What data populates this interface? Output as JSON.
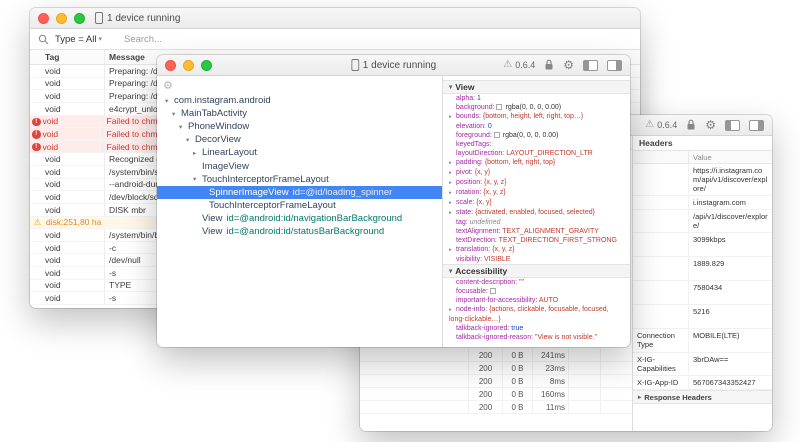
{
  "icons": {
    "warning": "⚠",
    "gear": "⚙",
    "chevron_down": "▾",
    "arrow_down": "▾",
    "arrow_right": "▸",
    "error_mark": "!"
  },
  "colors": {
    "selection_blue": "#4285f4",
    "error_red": "#cf3934",
    "warning_orange": "#e0891f",
    "prop_name_purple": "#a626a4",
    "enum_red": "#c0392b",
    "number_blue": "#1048bf",
    "tree_id_teal": "#00796b"
  },
  "log_window": {
    "title": "1 device running",
    "filter_label": "Type = All",
    "search_placeholder": "Search...",
    "columns": [
      "Tag",
      "Message"
    ],
    "rows": [
      {
        "severity": "normal",
        "tag": "void",
        "message": "Preparing: /data"
      },
      {
        "severity": "normal",
        "tag": "void",
        "message": "Preparing: /data"
      },
      {
        "severity": "normal",
        "tag": "void",
        "message": "Preparing: /data"
      },
      {
        "severity": "normal",
        "tag": "void",
        "message": "e4crypt_unlock_"
      },
      {
        "severity": "error",
        "tag": "void",
        "message": "Failed to chmod"
      },
      {
        "severity": "error",
        "tag": "void",
        "message": "Failed to chmod"
      },
      {
        "severity": "error",
        "tag": "void",
        "message": "Failed to chmod"
      },
      {
        "severity": "normal",
        "tag": "void",
        "message": "Recognized expe"
      },
      {
        "severity": "normal",
        "tag": "void",
        "message": "/system/bin/sgd"
      },
      {
        "severity": "normal",
        "tag": "void",
        "message": "--android-dump"
      },
      {
        "severity": "normal",
        "tag": "void",
        "message": "/dev/block/sd"
      },
      {
        "severity": "normal",
        "tag": "void",
        "message": "DISK mbr"
      },
      {
        "severity": "warning",
        "tag": "",
        "message": "disk:251,80 ha",
        "span": true
      },
      {
        "severity": "normal",
        "tag": "void",
        "message": "/system/bin/blk"
      },
      {
        "severity": "normal",
        "tag": "void",
        "message": "-c"
      },
      {
        "severity": "normal",
        "tag": "void",
        "message": "/dev/null"
      },
      {
        "severity": "normal",
        "tag": "void",
        "message": "-s"
      },
      {
        "severity": "normal",
        "tag": "void",
        "message": "TYPE"
      },
      {
        "severity": "normal",
        "tag": "void",
        "message": "-s"
      }
    ]
  },
  "layout_window": {
    "title": "1 device running",
    "version": "0.6.4",
    "tree": [
      {
        "indent": 0,
        "arrow": "down",
        "label": "com.instagram.android"
      },
      {
        "indent": 1,
        "arrow": "down",
        "label": "MainTabActivity"
      },
      {
        "indent": 2,
        "arrow": "down",
        "label": "PhoneWindow"
      },
      {
        "indent": 3,
        "arrow": "down",
        "label": "DecorView"
      },
      {
        "indent": 4,
        "arrow": "right",
        "label": "LinearLayout"
      },
      {
        "indent": 4,
        "arrow": "none",
        "label": "ImageView"
      },
      {
        "indent": 4,
        "arrow": "down",
        "label": "TouchInterceptorFrameLayout"
      },
      {
        "indent": 5,
        "arrow": "none",
        "label": "SpinnerImageView",
        "id": "id=@id/loading_spinner",
        "selected": true
      },
      {
        "indent": 5,
        "arrow": "none",
        "label": "TouchInterceptorFrameLayout"
      },
      {
        "indent": 4,
        "arrow": "none",
        "label": "View",
        "id": "id=@android:id/navigationBarBackground"
      },
      {
        "indent": 4,
        "arrow": "none",
        "label": "View",
        "id": "id=@android:id/statusBarBackground"
      }
    ],
    "sections": [
      {
        "title": "View",
        "props": [
          {
            "name": "alpha",
            "value": "1",
            "type": "number"
          },
          {
            "name": "background",
            "value": "rgba(0, 0, 0, 0.00)",
            "type": "color"
          },
          {
            "name": "bounds",
            "value": "{bottom, height, left, right, top…}",
            "type": "object"
          },
          {
            "name": "elevation",
            "value": "0",
            "type": "number"
          },
          {
            "name": "foreground",
            "value": "rgba(0, 0, 0, 0.00)",
            "type": "color"
          },
          {
            "name": "keyedTags",
            "value": "",
            "type": "empty"
          },
          {
            "name": "layoutDirection",
            "value": "LAYOUT_DIRECTION_LTR",
            "type": "enum"
          },
          {
            "name": "padding",
            "value": "{bottom, left, right, top}",
            "type": "object"
          },
          {
            "name": "pivot",
            "value": "{x, y}",
            "type": "object"
          },
          {
            "name": "position",
            "value": "{x, y, z}",
            "type": "object"
          },
          {
            "name": "rotation",
            "value": "{x, y, z}",
            "type": "object"
          },
          {
            "name": "scale",
            "value": "{x, y}",
            "type": "object"
          },
          {
            "name": "state",
            "value": "{activated, enabled, focused, selected}",
            "type": "object"
          },
          {
            "name": "tag",
            "value": "undefined",
            "type": "undefined"
          },
          {
            "name": "textAlignment",
            "value": "TEXT_ALIGNMENT_GRAVITY",
            "type": "enum"
          },
          {
            "name": "textDirection",
            "value": "TEXT_DIRECTION_FIRST_STRONG",
            "type": "enum"
          },
          {
            "name": "translation",
            "value": "{x, y, z}",
            "type": "object"
          },
          {
            "name": "visibility",
            "value": "VISIBLE",
            "type": "enum"
          }
        ]
      },
      {
        "title": "Accessibility",
        "props": [
          {
            "name": "content-description",
            "value": "\"\"",
            "type": "string"
          },
          {
            "name": "focusable",
            "value": "",
            "type": "checkbox"
          },
          {
            "name": "important-for-accessibility",
            "value": "AUTO",
            "type": "enum"
          },
          {
            "name": "node-info",
            "value": "{actions, clickable, focusable, focused, long-clickable…}",
            "type": "object"
          },
          {
            "name": "talkback-ignored",
            "value": "true",
            "type": "boolean"
          },
          {
            "name": "talkback-ignored-reason",
            "value": "\"View is not visible.\"",
            "type": "string"
          }
        ]
      }
    ]
  },
  "network_window": {
    "version": "0.6.4",
    "detail": {
      "title": "Headers",
      "value_column": "Value",
      "rows": [
        {
          "name": "",
          "value": "https://i.instagram.com/api/v1/discover/explore/"
        },
        {
          "name": "",
          "value": "i.instagram.com"
        },
        {
          "name": "",
          "value": "/api/v1/discover/explore/"
        },
        {
          "name": "",
          "value": "3099kbps",
          "tall": true
        },
        {
          "name": "",
          "value": "1889.829",
          "tall": true
        },
        {
          "name": "",
          "value": "7580434",
          "tall": true
        },
        {
          "name": "",
          "value": "5216",
          "tall": true
        },
        {
          "name": "Connection Type",
          "value": "MOBILE(LTE)",
          "tall": true
        },
        {
          "name": "X-IG-Capabilities",
          "value": "3brDAw=="
        },
        {
          "name": "X-IG-App-ID",
          "value": "567067343352427"
        }
      ],
      "section": "Response Headers"
    },
    "requests": [
      {
        "url": "",
        "status": "200",
        "size": "0 B",
        "time": "241ms"
      },
      {
        "url": "",
        "status": "200",
        "size": "0 B",
        "time": "23ms"
      },
      {
        "url": "",
        "status": "200",
        "size": "0 B",
        "time": "8ms"
      },
      {
        "url": "",
        "status": "200",
        "size": "0 B",
        "time": "160ms"
      },
      {
        "url": "",
        "status": "200",
        "size": "0 B",
        "time": "11ms"
      }
    ]
  }
}
